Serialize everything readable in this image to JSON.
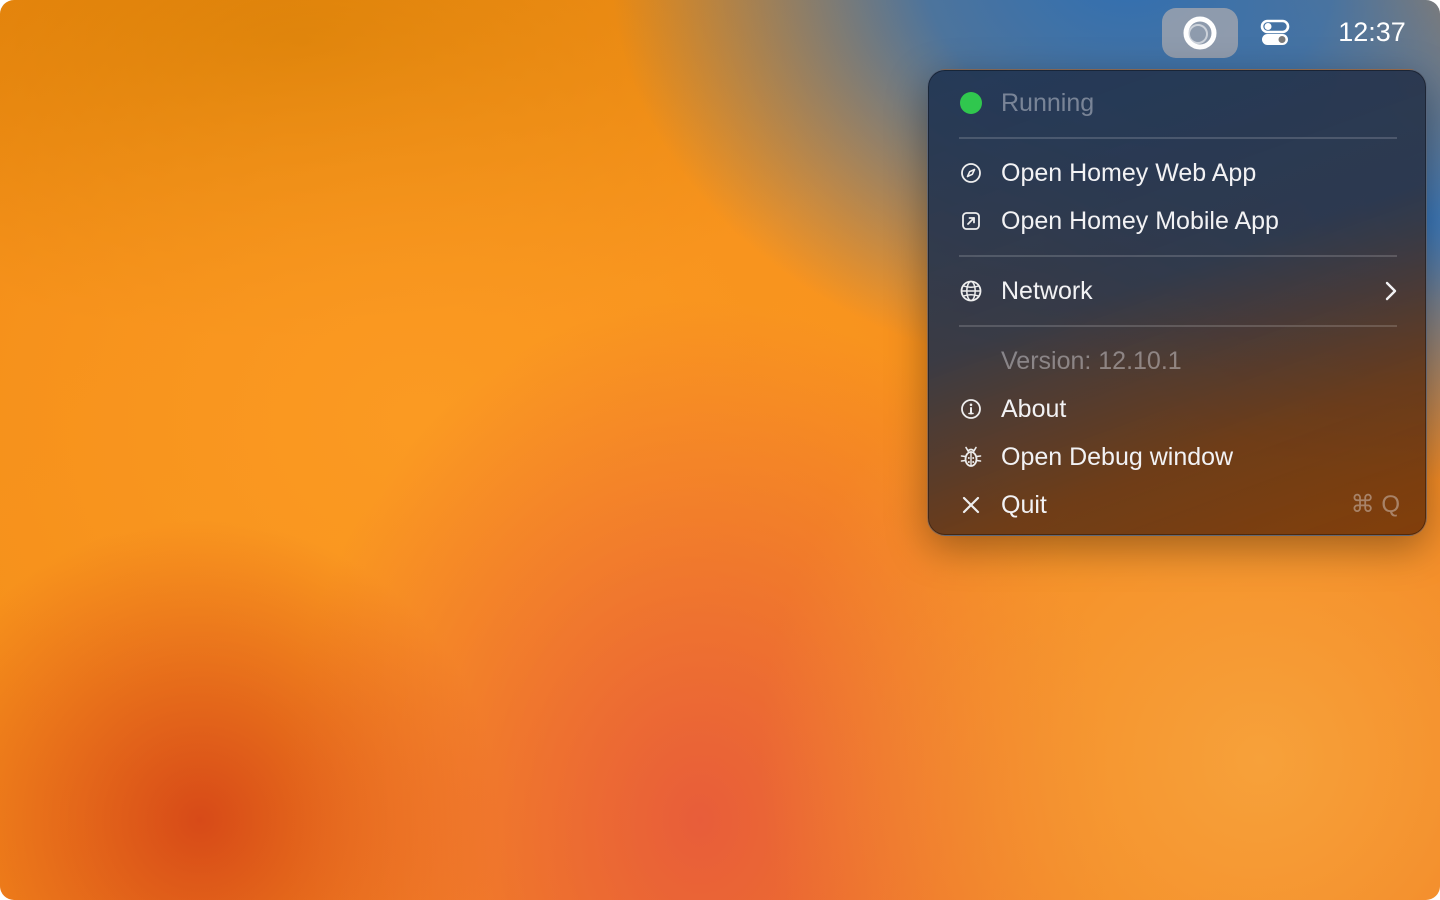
{
  "menubar": {
    "clock": "12:37",
    "homey_icon": "homey-ring-icon",
    "control_icon": "control-center-icon"
  },
  "menu": {
    "status": {
      "label": "Running",
      "color": "#30c74e"
    },
    "items": [
      {
        "label": "Open Homey Web App",
        "icon": "compass-icon"
      },
      {
        "label": "Open Homey Mobile App",
        "icon": "external-link-icon"
      },
      {
        "label": "Network",
        "icon": "globe-icon",
        "submenu": true
      },
      {
        "label": "Version: 12.10.1",
        "disabled": true
      },
      {
        "label": "About",
        "icon": "info-icon"
      },
      {
        "label": "Open Debug window",
        "icon": "bug-icon"
      },
      {
        "label": "Quit",
        "icon": "close-icon",
        "shortcut": "⌘ Q"
      }
    ]
  }
}
